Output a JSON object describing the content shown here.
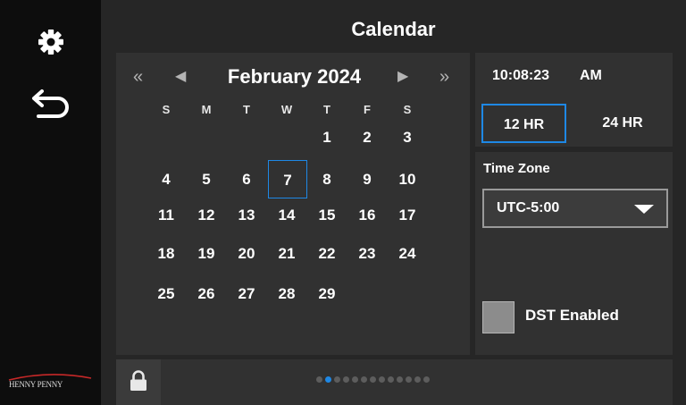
{
  "header": {
    "title": "Calendar"
  },
  "sidebar": {
    "settings_icon": "gear-icon",
    "back_icon": "back-arrow-icon",
    "logo_text": "HENNY PENNY"
  },
  "calendar": {
    "month_label": "February 2024",
    "nav": {
      "prev_year": "«",
      "prev_month": "◀",
      "next_month": "▶",
      "next_year": "»"
    },
    "weekdays": [
      "S",
      "M",
      "T",
      "W",
      "T",
      "F",
      "S"
    ],
    "days": [
      "1",
      "2",
      "3",
      "4",
      "5",
      "6",
      "7",
      "8",
      "9",
      "10",
      "11",
      "12",
      "13",
      "14",
      "15",
      "16",
      "17",
      "18",
      "19",
      "20",
      "21",
      "22",
      "23",
      "24",
      "25",
      "26",
      "27",
      "28",
      "29"
    ],
    "first_weekday_index": 4,
    "selected_day": "7"
  },
  "clock": {
    "time": "10:08:23",
    "ampm": "AM",
    "format_12": "12 HR",
    "format_24": "24 HR",
    "active_format": "12 HR"
  },
  "timezone": {
    "label": "Time Zone",
    "value": "UTC-5:00"
  },
  "dst": {
    "label": "DST Enabled",
    "checked": false
  },
  "pager": {
    "total": 13,
    "active_index": 1
  },
  "colors": {
    "accent": "#1e88e5",
    "panel": "#313131",
    "background": "#262626",
    "sidebar": "#0d0d0d"
  }
}
